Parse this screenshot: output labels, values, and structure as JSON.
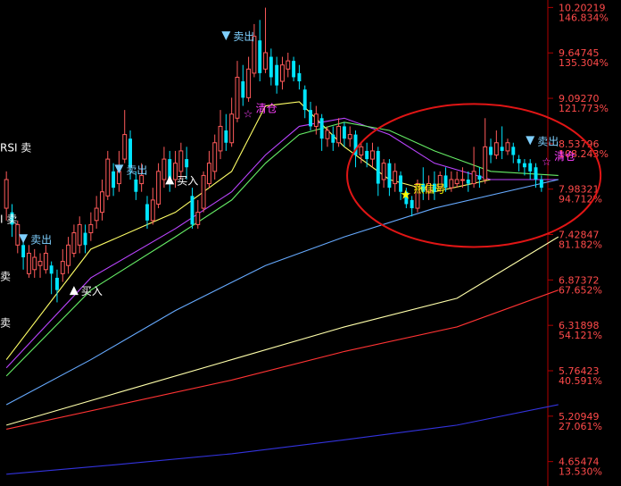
{
  "colors": {
    "background": "#000000",
    "axis": "#b00000",
    "up_candle": "#ff5a5a",
    "down_candle": "#00e5ff",
    "axis_text": "#ff4a4a",
    "circle": "#e01515",
    "signal_buy": "#ffffff",
    "signal_sell": "#7fd0ff",
    "signal_clear": "#ff40ff",
    "signal_star": "#ffff00"
  },
  "chart_data": {
    "type": "candlestick",
    "title": "",
    "ylim": [
      4.4,
      10.25
    ],
    "axis_labels": [
      {
        "price": "10.20219",
        "pct": "146.834%"
      },
      {
        "price": "9.64745",
        "pct": "135.304%"
      },
      {
        "price": "9.09270",
        "pct": "121.773%"
      },
      {
        "price": "8.53796",
        "pct": "108.243%"
      },
      {
        "price": "7.98321",
        "pct": "94.712%"
      },
      {
        "price": "7.42847",
        "pct": "81.182%"
      },
      {
        "price": "6.87372",
        "pct": "67.652%"
      },
      {
        "price": "6.31898",
        "pct": "54.121%"
      },
      {
        "price": "5.76423",
        "pct": "40.591%"
      },
      {
        "price": "5.20949",
        "pct": "27.061%"
      },
      {
        "price": "4.65474",
        "pct": "13.530%"
      }
    ],
    "candles": [
      [
        7.75,
        8.1,
        7.6,
        8.2
      ],
      [
        7.7,
        7.55,
        7.4,
        7.8
      ],
      [
        7.3,
        7.55,
        7.2,
        7.6
      ],
      [
        7.3,
        7.15,
        7.0,
        7.35
      ],
      [
        6.95,
        7.2,
        6.9,
        7.3
      ],
      [
        7.0,
        7.15,
        6.9,
        7.25
      ],
      [
        7.05,
        7.1,
        6.9,
        7.2
      ],
      [
        7.0,
        7.2,
        6.95,
        7.3
      ],
      [
        7.05,
        6.95,
        6.7,
        7.1
      ],
      [
        6.9,
        6.75,
        6.6,
        7.0
      ],
      [
        6.95,
        7.1,
        6.85,
        7.25
      ],
      [
        7.05,
        7.3,
        6.95,
        7.4
      ],
      [
        7.2,
        7.45,
        7.15,
        7.55
      ],
      [
        7.3,
        7.55,
        7.2,
        7.65
      ],
      [
        7.45,
        7.3,
        7.2,
        7.55
      ],
      [
        7.45,
        7.55,
        7.35,
        7.7
      ],
      [
        7.6,
        7.75,
        7.5,
        7.9
      ],
      [
        7.7,
        7.95,
        7.6,
        8.1
      ],
      [
        7.9,
        8.35,
        7.85,
        8.45
      ],
      [
        8.2,
        8.0,
        7.9,
        8.3
      ],
      [
        8.05,
        8.2,
        7.95,
        8.45
      ],
      [
        8.35,
        8.65,
        8.3,
        8.95
      ],
      [
        8.6,
        8.25,
        8.1,
        8.7
      ],
      [
        8.1,
        7.95,
        7.85,
        8.2
      ],
      [
        8.05,
        8.15,
        7.95,
        8.3
      ],
      [
        7.8,
        7.6,
        7.5,
        7.9
      ],
      [
        7.6,
        7.85,
        7.55,
        8.0
      ],
      [
        7.8,
        8.2,
        7.75,
        8.3
      ],
      [
        8.1,
        8.35,
        8.0,
        8.5
      ],
      [
        8.35,
        8.05,
        7.95,
        8.45
      ],
      [
        8.1,
        8.3,
        8.0,
        8.45
      ],
      [
        8.2,
        8.45,
        8.1,
        8.55
      ],
      [
        8.35,
        8.25,
        8.1,
        8.5
      ],
      [
        7.9,
        7.55,
        7.5,
        8.0
      ],
      [
        7.55,
        7.7,
        7.5,
        7.85
      ],
      [
        7.75,
        8.15,
        7.7,
        8.2
      ],
      [
        8.05,
        8.3,
        8.0,
        8.45
      ],
      [
        8.2,
        8.55,
        8.1,
        8.65
      ],
      [
        8.45,
        8.75,
        8.35,
        8.95
      ],
      [
        8.7,
        8.55,
        8.45,
        8.9
      ],
      [
        8.55,
        8.9,
        8.5,
        9.1
      ],
      [
        8.85,
        9.35,
        8.8,
        9.55
      ],
      [
        9.3,
        9.1,
        9.0,
        9.5
      ],
      [
        9.1,
        9.45,
        9.05,
        9.6
      ],
      [
        9.4,
        9.85,
        9.35,
        10.0
      ],
      [
        9.8,
        9.4,
        9.3,
        10.05
      ],
      [
        9.45,
        9.65,
        9.4,
        10.2
      ],
      [
        9.6,
        9.35,
        9.25,
        9.7
      ],
      [
        9.5,
        9.25,
        9.15,
        9.6
      ],
      [
        9.3,
        9.5,
        9.2,
        9.6
      ],
      [
        9.45,
        9.55,
        9.35,
        9.65
      ],
      [
        9.55,
        9.35,
        9.3,
        9.6
      ],
      [
        9.4,
        9.3,
        9.2,
        9.5
      ],
      [
        9.2,
        8.95,
        8.85,
        9.25
      ],
      [
        8.95,
        8.75,
        8.7,
        9.05
      ],
      [
        8.75,
        8.9,
        8.65,
        9.0
      ],
      [
        8.85,
        8.6,
        8.45,
        8.9
      ],
      [
        8.6,
        8.7,
        8.5,
        8.75
      ],
      [
        8.65,
        8.55,
        8.45,
        8.75
      ],
      [
        8.55,
        8.75,
        8.5,
        8.85
      ],
      [
        8.75,
        8.6,
        8.5,
        8.8
      ],
      [
        8.6,
        8.65,
        8.5,
        8.75
      ],
      [
        8.65,
        8.4,
        8.25,
        8.7
      ],
      [
        8.4,
        8.5,
        8.3,
        8.55
      ],
      [
        8.45,
        8.35,
        8.25,
        8.55
      ],
      [
        8.35,
        8.45,
        8.25,
        8.55
      ],
      [
        8.45,
        8.05,
        7.9,
        8.5
      ],
      [
        8.1,
        8.3,
        8.0,
        8.35
      ],
      [
        8.3,
        8.0,
        7.9,
        8.35
      ],
      [
        8.05,
        8.2,
        7.95,
        8.3
      ],
      [
        8.15,
        7.95,
        7.85,
        8.2
      ],
      [
        7.95,
        7.8,
        7.75,
        8.0
      ],
      [
        7.85,
        7.75,
        7.65,
        7.9
      ],
      [
        7.75,
        8.05,
        7.7,
        8.1
      ],
      [
        8.05,
        7.95,
        7.85,
        8.25
      ],
      [
        7.95,
        8.05,
        7.85,
        8.15
      ],
      [
        8.05,
        7.95,
        7.85,
        8.2
      ],
      [
        8.0,
        8.15,
        7.95,
        8.2
      ],
      [
        8.15,
        8.0,
        7.95,
        8.25
      ],
      [
        8.0,
        8.1,
        7.95,
        8.2
      ],
      [
        8.05,
        8.1,
        8.0,
        8.2
      ],
      [
        8.1,
        8.1,
        8.0,
        8.25
      ],
      [
        8.1,
        8.05,
        7.95,
        8.2
      ],
      [
        8.05,
        8.2,
        8.0,
        8.5
      ],
      [
        8.15,
        8.1,
        8.0,
        8.25
      ],
      [
        8.1,
        8.5,
        8.05,
        8.85
      ],
      [
        8.5,
        8.4,
        8.3,
        8.6
      ],
      [
        8.4,
        8.55,
        8.35,
        8.7
      ],
      [
        8.5,
        8.45,
        8.35,
        8.75
      ],
      [
        8.45,
        8.55,
        8.4,
        8.6
      ],
      [
        8.5,
        8.4,
        8.3,
        8.55
      ],
      [
        8.35,
        8.3,
        8.2,
        8.4
      ],
      [
        8.3,
        8.25,
        8.15,
        8.35
      ],
      [
        8.3,
        8.2,
        8.1,
        8.35
      ],
      [
        8.25,
        8.1,
        8.0,
        8.3
      ],
      [
        8.1,
        8.0,
        7.95,
        8.15
      ]
    ],
    "moving_averages": [
      {
        "color": "#ffff66",
        "values": [
          [
            0,
            5.9
          ],
          [
            15,
            7.25
          ],
          [
            30,
            7.7
          ],
          [
            40,
            8.2
          ],
          [
            46,
            9.0
          ],
          [
            52,
            9.05
          ],
          [
            60,
            8.5
          ],
          [
            68,
            8.1
          ],
          [
            76,
            7.95
          ],
          [
            86,
            8.1
          ],
          [
            98,
            8.1
          ]
        ]
      },
      {
        "color": "#bb44ff",
        "values": [
          [
            0,
            5.8
          ],
          [
            15,
            6.9
          ],
          [
            30,
            7.5
          ],
          [
            40,
            7.95
          ],
          [
            46,
            8.4
          ],
          [
            52,
            8.75
          ],
          [
            60,
            8.85
          ],
          [
            68,
            8.65
          ],
          [
            76,
            8.3
          ],
          [
            86,
            8.1
          ],
          [
            98,
            8.1
          ]
        ]
      },
      {
        "color": "#66ee66",
        "values": [
          [
            0,
            5.7
          ],
          [
            15,
            6.75
          ],
          [
            30,
            7.4
          ],
          [
            40,
            7.85
          ],
          [
            46,
            8.3
          ],
          [
            52,
            8.65
          ],
          [
            60,
            8.8
          ],
          [
            68,
            8.7
          ],
          [
            76,
            8.45
          ],
          [
            86,
            8.2
          ],
          [
            98,
            8.15
          ]
        ]
      },
      {
        "color": "#66aaff",
        "values": [
          [
            0,
            5.35
          ],
          [
            15,
            5.9
          ],
          [
            30,
            6.5
          ],
          [
            46,
            7.05
          ],
          [
            60,
            7.4
          ],
          [
            76,
            7.75
          ],
          [
            98,
            8.1
          ]
        ]
      },
      {
        "color": "#ffffaa",
        "values": [
          [
            0,
            5.1
          ],
          [
            20,
            5.5
          ],
          [
            40,
            5.9
          ],
          [
            60,
            6.3
          ],
          [
            80,
            6.65
          ],
          [
            98,
            7.4
          ]
        ]
      },
      {
        "color": "#ff3333",
        "values": [
          [
            0,
            5.05
          ],
          [
            20,
            5.35
          ],
          [
            40,
            5.65
          ],
          [
            60,
            6.0
          ],
          [
            80,
            6.3
          ],
          [
            98,
            6.75
          ]
        ]
      },
      {
        "color": "#3333dd",
        "values": [
          [
            0,
            4.5
          ],
          [
            20,
            4.62
          ],
          [
            40,
            4.75
          ],
          [
            60,
            4.92
          ],
          [
            80,
            5.1
          ],
          [
            98,
            5.35
          ]
        ]
      }
    ],
    "signals": [
      {
        "label": "RSI 卖",
        "kind": "text",
        "color": "#ffffff",
        "index": 0,
        "price": 8.42
      },
      {
        "label": "I 卖",
        "kind": "text",
        "color": "#ffffff",
        "index": 0,
        "price": 7.55
      },
      {
        "label": "卖",
        "kind": "text",
        "color": "#ffffff",
        "index": 0,
        "price": 6.85
      },
      {
        "label": "卖",
        "kind": "text",
        "color": "#ffffff",
        "index": 0,
        "price": 6.28
      },
      {
        "label": "卖出",
        "kind": "sell",
        "color": "#7fd0ff",
        "index": 3,
        "price": 7.3
      },
      {
        "label": "卖出",
        "kind": "sell",
        "color": "#7fd0ff",
        "index": 20,
        "price": 8.15
      },
      {
        "label": "卖出",
        "kind": "sell",
        "color": "#7fd0ff",
        "index": 39,
        "price": 9.78
      },
      {
        "label": "卖出",
        "kind": "sell",
        "color": "#7fd0ff",
        "index": 93,
        "price": 8.5
      },
      {
        "label": "买入",
        "kind": "buy",
        "color": "#ffffff",
        "index": 12,
        "price": 6.8
      },
      {
        "label": "买入",
        "kind": "buy",
        "color": "#ffffff",
        "index": 29,
        "price": 8.15
      },
      {
        "label": "清仓",
        "kind": "clear",
        "color": "#ff40ff",
        "index": 43,
        "price": 8.9
      },
      {
        "label": "清仓",
        "kind": "clear",
        "color": "#ff40ff",
        "index": 96,
        "price": 8.32
      },
      {
        "label": "燕信号",
        "kind": "star",
        "color": "#ffff00",
        "index": 71,
        "price": 7.92
      }
    ],
    "highlight_circle": {
      "center_index": 83,
      "center_price": 8.15,
      "radius_candles": 18,
      "radius_price": 0.95
    }
  }
}
